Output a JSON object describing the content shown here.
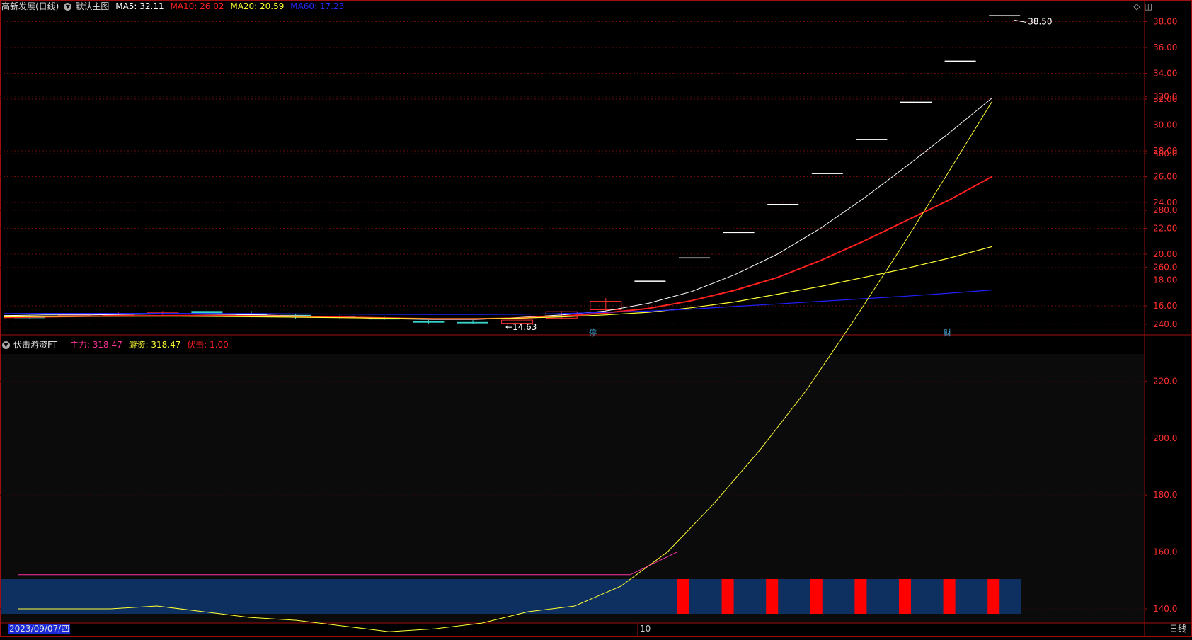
{
  "main_header": {
    "title": "高新发展(日线)",
    "chart_name": "默认主图",
    "ma5_label": "MA5: 32.11",
    "ma10_label": "MA10: 26.02",
    "ma20_label": "MA20: 20.59",
    "ma60_label": "MA60: 17.23"
  },
  "sub_header": {
    "title": "伏击游资FT",
    "zhuli_label": "主力: 318.47",
    "youzi_label": "游资: 318.47",
    "fuji_label": "伏击: 1.00"
  },
  "markers": {
    "ting": "停",
    "cai": "财",
    "high_label": "38.50",
    "low_label": "14.63"
  },
  "footer": {
    "date": "2023/09/07/四",
    "month_tick": "10",
    "period": "日线"
  },
  "colors": {
    "up": "#ff3030",
    "down": "#38d0c8",
    "ma5": "#ffffff",
    "ma10": "#ff2020",
    "ma20": "#ffff33",
    "ma60": "#2020ff",
    "axis": "#a01010",
    "band": "#0e3060"
  },
  "chart_data": [
    {
      "type": "line",
      "title": "",
      "ylim": [
        14.0,
        38.5
      ],
      "yticks": [
        "16.00",
        "18.00",
        "20.00",
        "22.00",
        "24.00",
        "26.00",
        "28.00",
        "30.00",
        "32.00",
        "34.00",
        "36.00",
        "38.00"
      ],
      "x": [
        1,
        2,
        3,
        4,
        5,
        6,
        7,
        8,
        9,
        10,
        11,
        12,
        13,
        14,
        15,
        16,
        17,
        18,
        19,
        20,
        21,
        22
      ],
      "candles": [
        {
          "o": 15.2,
          "c": 15.05,
          "h": 15.3,
          "l": 15.0
        },
        {
          "o": 15.25,
          "c": 15.3,
          "h": 15.4,
          "l": 15.2
        },
        {
          "o": 15.3,
          "c": 15.35,
          "h": 15.5,
          "l": 15.2
        },
        {
          "o": 15.4,
          "c": 15.5,
          "h": 15.6,
          "l": 15.3
        },
        {
          "o": 15.6,
          "c": 15.4,
          "h": 15.7,
          "l": 15.3
        },
        {
          "o": 15.4,
          "c": 15.2,
          "h": 15.6,
          "l": 15.1
        },
        {
          "o": 15.3,
          "c": 15.15,
          "h": 15.4,
          "l": 15.0
        },
        {
          "o": 15.2,
          "c": 15.1,
          "h": 15.3,
          "l": 15.0
        },
        {
          "o": 15.1,
          "c": 14.95,
          "h": 15.2,
          "l": 14.9
        },
        {
          "o": 14.8,
          "c": 14.7,
          "h": 14.9,
          "l": 14.6
        },
        {
          "o": 14.75,
          "c": 14.65,
          "h": 14.9,
          "l": 14.6
        },
        {
          "o": 14.65,
          "c": 14.9,
          "h": 15.0,
          "l": 14.63
        },
        {
          "o": 15.05,
          "c": 15.55,
          "h": 15.6,
          "l": 15.0
        },
        {
          "o": 15.7,
          "c": 16.35,
          "h": 16.6,
          "l": 15.6
        },
        {
          "o": 17.95,
          "c": 17.95,
          "h": 17.95,
          "l": 17.95
        },
        {
          "o": 19.75,
          "c": 19.75,
          "h": 19.75,
          "l": 19.75
        },
        {
          "o": 21.72,
          "c": 21.72,
          "h": 21.72,
          "l": 21.72
        },
        {
          "o": 23.89,
          "c": 23.89,
          "h": 23.89,
          "l": 23.89
        },
        {
          "o": 26.28,
          "c": 26.28,
          "h": 26.28,
          "l": 26.28
        },
        {
          "o": 28.91,
          "c": 28.91,
          "h": 28.91,
          "l": 28.91
        },
        {
          "o": 31.8,
          "c": 31.8,
          "h": 31.8,
          "l": 31.8
        },
        {
          "o": 34.98,
          "c": 34.98,
          "h": 34.98,
          "l": 34.98
        },
        {
          "o": 38.5,
          "c": 38.5,
          "h": 38.5,
          "l": 38.5
        }
      ],
      "series": [
        {
          "name": "MA5",
          "values": [
            15.25,
            15.3,
            15.3,
            15.35,
            15.38,
            15.35,
            15.3,
            15.22,
            15.12,
            15.0,
            14.95,
            14.95,
            15.1,
            15.3,
            15.6,
            16.2,
            17.1,
            18.4,
            20.0,
            22.0,
            24.3,
            26.8,
            29.4,
            32.11
          ]
        },
        {
          "name": "MA10",
          "values": [
            15.1,
            15.15,
            15.2,
            15.22,
            15.25,
            15.25,
            15.22,
            15.18,
            15.12,
            15.05,
            15.0,
            15.0,
            15.05,
            15.2,
            15.45,
            15.8,
            16.4,
            17.2,
            18.2,
            19.5,
            21.0,
            22.6,
            24.2,
            26.02
          ]
        },
        {
          "name": "MA20",
          "values": [
            15.15,
            15.18,
            15.2,
            15.2,
            15.2,
            15.18,
            15.15,
            15.12,
            15.08,
            15.04,
            15.0,
            15.0,
            15.05,
            15.15,
            15.3,
            15.5,
            15.85,
            16.3,
            16.9,
            17.5,
            18.2,
            18.9,
            19.7,
            20.59
          ]
        },
        {
          "name": "MA60",
          "values": [
            15.4,
            15.42,
            15.42,
            15.42,
            15.42,
            15.41,
            15.4,
            15.38,
            15.36,
            15.34,
            15.33,
            15.33,
            15.35,
            15.4,
            15.5,
            15.6,
            15.75,
            15.95,
            16.15,
            16.35,
            16.55,
            16.75,
            16.98,
            17.23
          ]
        }
      ]
    },
    {
      "type": "line",
      "title": "",
      "ylim": [
        135,
        322
      ],
      "yticks": [
        "140.0",
        "160.0",
        "180.0",
        "200.0",
        "220.0",
        "240.0",
        "260.0",
        "280.0",
        "300.0",
        "320.0"
      ],
      "series": [
        {
          "name": "游资",
          "values": [
            140,
            140,
            140,
            141,
            139,
            137,
            136,
            134,
            132,
            133,
            135,
            139,
            141,
            148,
            160,
            177,
            196,
            217,
            241,
            266,
            292,
            318.47
          ]
        },
        {
          "name": "主力",
          "values": [
            152,
            152,
            152,
            152,
            152,
            152,
            152,
            152,
            152,
            152,
            152,
            152,
            152,
            152,
            160
          ]
        }
      ],
      "fuji_bars": 8,
      "fuji_value": 1.0
    }
  ]
}
